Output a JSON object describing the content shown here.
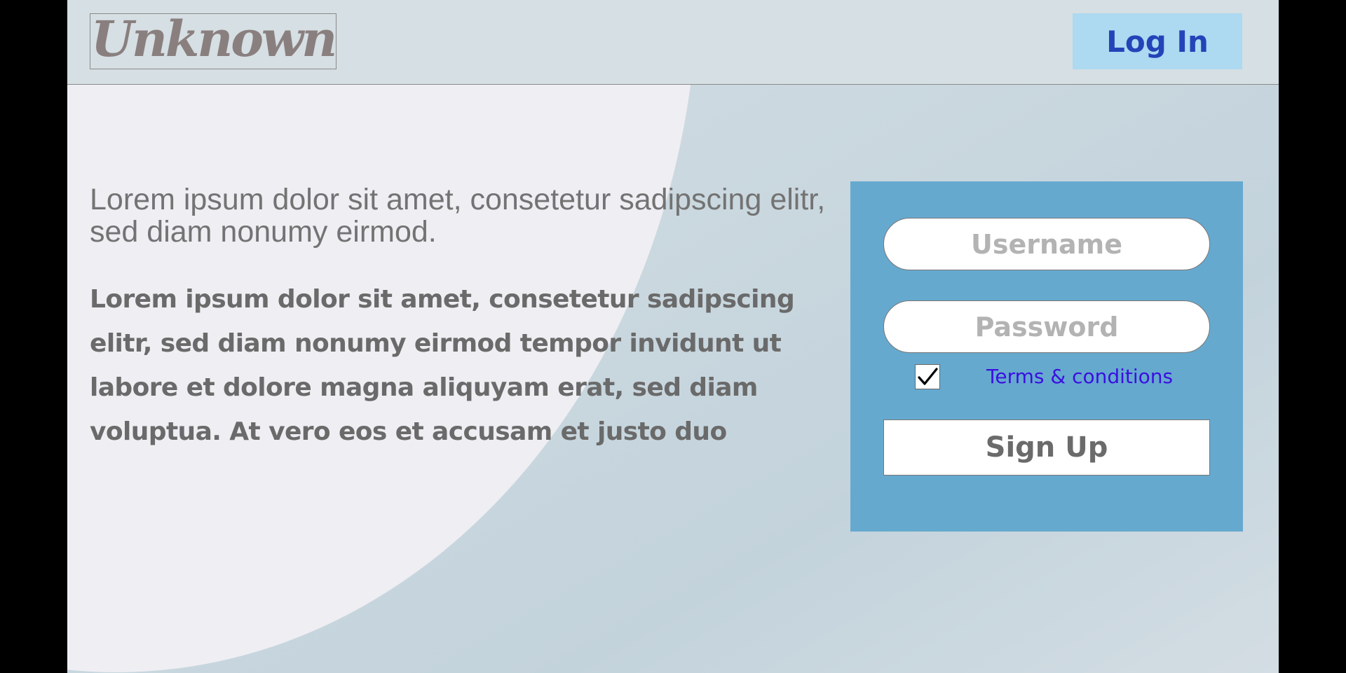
{
  "header": {
    "logo_text": "Unknown",
    "login_label": "Log In"
  },
  "main": {
    "lead": "Lorem ipsum dolor sit amet, consetetur sadipscing elitr, sed diam nonumy eirmod.",
    "body": "Lorem ipsum dolor sit amet, consetetur sadipscing elitr, sed diam nonumy eirmod tempor invidunt ut labore et dolore magna aliquyam erat, sed diam voluptua. At vero eos et accusam et justo duo"
  },
  "form": {
    "username_placeholder": "Username",
    "password_placeholder": "Password",
    "terms_checked": true,
    "terms_label": "Terms & conditions",
    "signup_label": "Sign Up"
  },
  "colors": {
    "panel": "#66a9cf",
    "login_button_bg": "#add9f1",
    "login_button_text": "#2344b8",
    "terms_link": "#3a10e0"
  },
  "icons": {
    "checkbox": "checkmark-icon"
  }
}
